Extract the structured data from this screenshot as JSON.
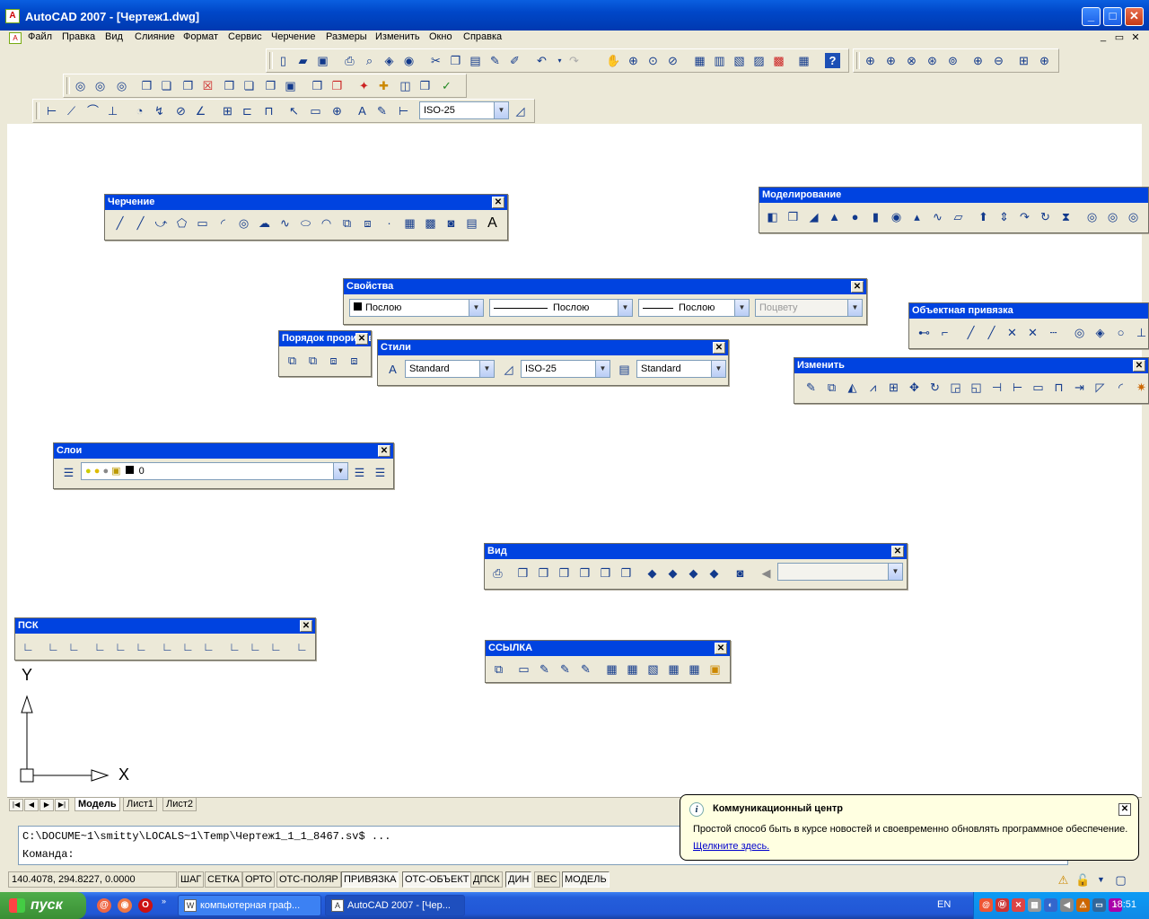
{
  "window": {
    "title": "AutoCAD 2007 - [Чертеж1.dwg]",
    "min": "_",
    "max": "□",
    "close": "✕"
  },
  "menu": [
    "Файл",
    "Правка",
    "Вид",
    "Слияние",
    "Формат",
    "Сервис",
    "Черчение",
    "Размеры",
    "Изменить",
    "Окно",
    "Справка"
  ],
  "mdi": {
    "min": "_",
    "restore": "▭",
    "close": "✕"
  },
  "toolbar": {
    "dimstyle": "ISO-25"
  },
  "panels": {
    "drawing": {
      "title": "Черчение",
      "text_icon": "A"
    },
    "modeling": {
      "title": "Моделирование"
    },
    "properties": {
      "title": "Свойства",
      "color": "Послою",
      "linetype": "Послою",
      "lineweight": "Послою",
      "plotstyle": "Поцвету"
    },
    "osnap": {
      "title": "Объектная привязка"
    },
    "draworder": {
      "title": "Порядок прорисовки"
    },
    "styles": {
      "title": "Стили",
      "text": "Standard",
      "dim": "ISO-25",
      "table": "Standard"
    },
    "modify": {
      "title": "Изменить"
    },
    "layers": {
      "title": "Слои",
      "layer": "0"
    },
    "view": {
      "title": "Вид"
    },
    "reference": {
      "title": "ССЫЛКА"
    },
    "ucs": {
      "title": "ПСК"
    }
  },
  "ucs_icon": {
    "y": "Y",
    "x": "X"
  },
  "tabs": [
    "Модель",
    "Лист1",
    "Лист2"
  ],
  "command": {
    "line1": "C:\\DOCUME~1\\smitty\\LOCALS~1\\Temp\\Чертеж1_1_1_8467.sv$ ...",
    "line2": "Команда:"
  },
  "status": {
    "coords": "140.4078, 294.8227, 0.0000",
    "buttons": [
      {
        "label": "ШАГ",
        "on": false
      },
      {
        "label": "СЕТКА",
        "on": false
      },
      {
        "label": "ОРТО",
        "on": false
      },
      {
        "label": "ОТС-ПОЛЯР",
        "on": false
      },
      {
        "label": "ПРИВЯЗКА",
        "on": true
      },
      {
        "label": "ОТС-ОБЪЕКТ",
        "on": true
      },
      {
        "label": "ДПСК",
        "on": false
      },
      {
        "label": "ДИН",
        "on": true
      },
      {
        "label": "ВЕС",
        "on": false
      },
      {
        "label": "МОДЕЛЬ",
        "on": true
      }
    ]
  },
  "balloon": {
    "title": "Коммуникационный центр",
    "text": "Простой способ быть в курсе новостей и своевременно обновлять программное обеспечение.",
    "link": "Щелкните здесь."
  },
  "taskbar": {
    "start": "пуск",
    "tasks": [
      {
        "label": "компьютерная граф...",
        "active": false
      },
      {
        "label": "AutoCAD 2007 - [Чер...",
        "active": true
      }
    ],
    "lang": "EN",
    "clock": "18:51"
  },
  "colors": {
    "titlebar": "#0047c8",
    "panel_header": "#0043e0",
    "taskbar": "#245edb",
    "start": "#3a8f34",
    "balloon": "#ffffe1"
  }
}
